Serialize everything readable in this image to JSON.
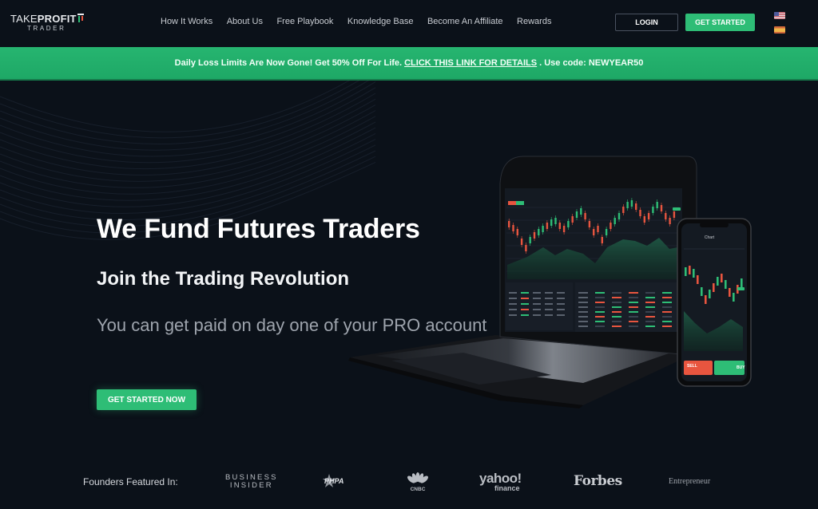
{
  "brand": {
    "name_light": "TAKE",
    "name_bold": "PROFIT",
    "tagline": "TRADER"
  },
  "nav": {
    "items": [
      {
        "label": "How It Works"
      },
      {
        "label": "About Us"
      },
      {
        "label": "Free Playbook"
      },
      {
        "label": "Knowledge Base"
      },
      {
        "label": "Become An Affiliate"
      },
      {
        "label": "Rewards"
      }
    ],
    "login_label": "LOGIN",
    "get_started_label": "GET STARTED",
    "languages": [
      {
        "name": "English",
        "icon": "us-flag-icon"
      },
      {
        "name": "Spanish",
        "icon": "spain-flag-icon"
      }
    ]
  },
  "banner": {
    "text_before": "Daily Loss Limits Are Now Gone! Get 50% Off For Life.",
    "link_text": "CLICK THIS LINK FOR DETAILS",
    "text_after": ". Use code: NEWYEAR50"
  },
  "hero": {
    "title": "We Fund Futures Traders",
    "subtitle": "Join the Trading Revolution",
    "description": "You can get paid on day one of your PRO account",
    "cta_label": "GET STARTED NOW"
  },
  "devices": {
    "phone_header": "Chart",
    "phone_sell": "SELL",
    "phone_buy": "BUY"
  },
  "featured": {
    "label": "Founders Featured In:",
    "outlets": [
      {
        "name": "Business Insider",
        "line1": "BUSINESS",
        "line2": "INSIDER"
      },
      {
        "name": "PHPA",
        "text": "PHPA"
      },
      {
        "name": "CNBC",
        "text": "CNBC"
      },
      {
        "name": "Yahoo Finance",
        "line1": "yahoo!",
        "line2": "finance"
      },
      {
        "name": "Forbes",
        "text": "Forbes"
      },
      {
        "name": "Entrepreneur",
        "text": "Entrepreneur"
      }
    ]
  },
  "colors": {
    "background": "#0b1119",
    "accent_green": "#2ebd76",
    "banner_green": "#22b06b",
    "candle_up": "#2ebd76",
    "candle_down": "#e8553f"
  }
}
